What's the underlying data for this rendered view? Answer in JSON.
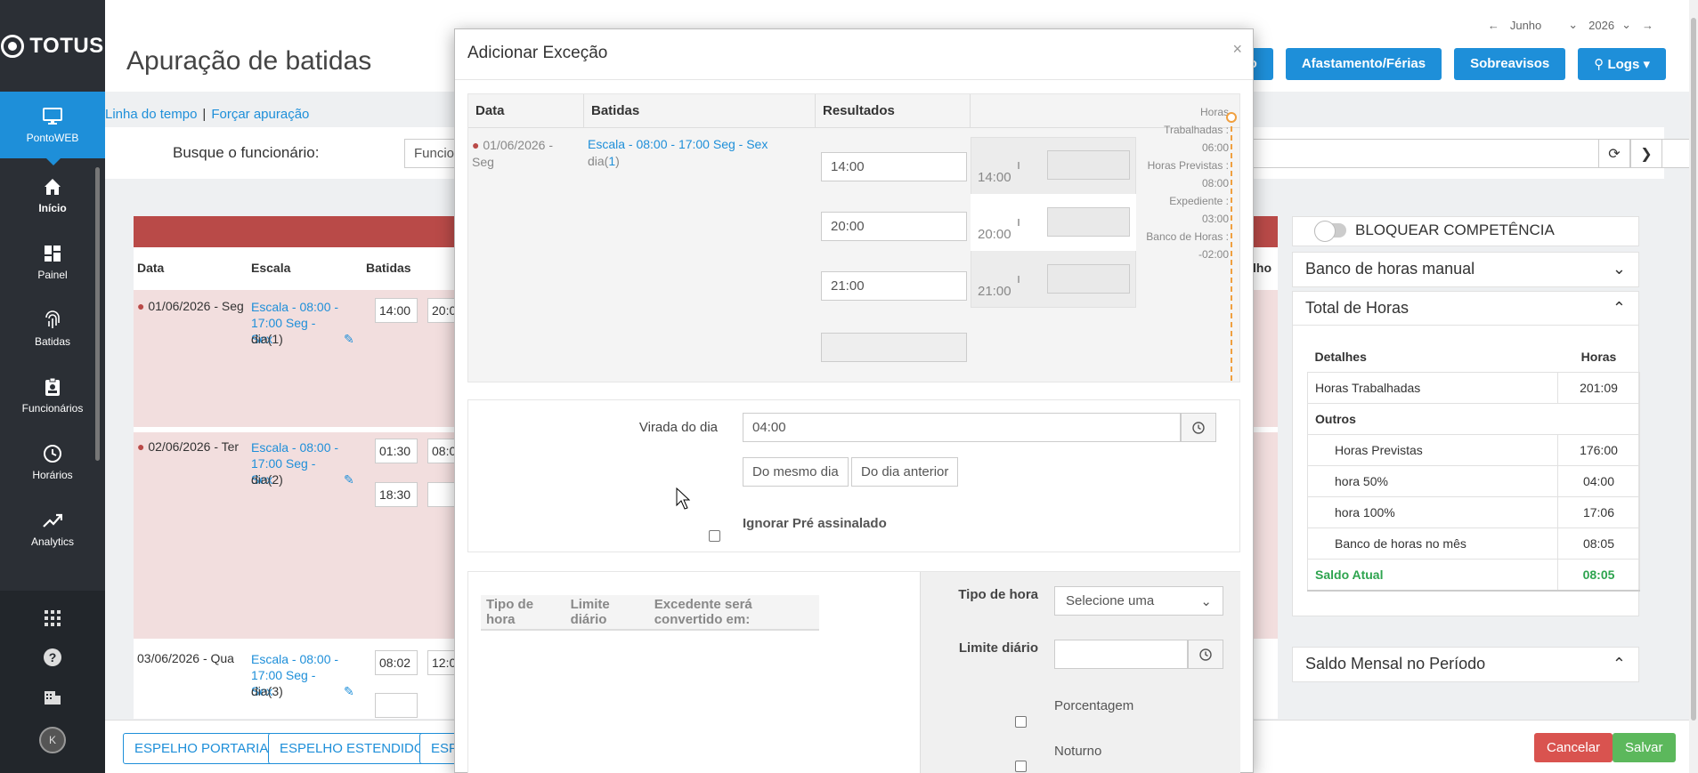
{
  "app": {
    "logo": "TOTUS",
    "page_title": "Apuração de batidas"
  },
  "sidebar": {
    "items": [
      {
        "label": "PontoWEB",
        "icon": "monitor-icon"
      },
      {
        "label": "Início",
        "icon": "home-icon"
      },
      {
        "label": "Painel",
        "icon": "dashboard-icon"
      },
      {
        "label": "Batidas",
        "icon": "fingerprint-icon"
      },
      {
        "label": "Funcionários",
        "icon": "badge-icon"
      },
      {
        "label": "Horários",
        "icon": "clock-icon"
      },
      {
        "label": "Analytics",
        "icon": "trending-icon"
      }
    ],
    "avatar_initial": "K"
  },
  "header": {
    "month": "Junho",
    "year": "2026",
    "buttons": {
      "partial": "ário",
      "afastamento": "Afastamento/Férias",
      "sobreavisos": "Sobreavisos",
      "logs": "Logs"
    }
  },
  "links": {
    "timeline": "Linha do tempo",
    "sep": "|",
    "force": "Forçar apuração"
  },
  "search": {
    "label": "Busque o funcionário:",
    "placeholder": "Funcio"
  },
  "table": {
    "headers": {
      "data": "Data",
      "escala": "Escala",
      "batidas": "Batidas",
      "partial": "lho"
    },
    "rows": [
      {
        "date": "01/06/2026 - Seg",
        "escala": "Escala - 08:00 - 17:00 Seg - Sex",
        "dia": "dia(1)",
        "batidas": [
          "14:00",
          "20:0"
        ]
      },
      {
        "date": "02/06/2026 - Ter",
        "escala": "Escala - 08:00 - 17:00 Seg - Sex",
        "dia": "dia(2)",
        "batidas": [
          "01:30",
          "08:0",
          "18:30",
          ""
        ]
      },
      {
        "date": "03/06/2026 - Qua",
        "escala": "Escala - 08:00 - 17:00 Seg - Sex",
        "dia": "dia(3)",
        "batidas": [
          "08:02",
          "12:0",
          ""
        ]
      }
    ]
  },
  "right_panels": {
    "bloquear": "BLOQUEAR COMPETÊNCIA",
    "banco_manual": "Banco de horas manual",
    "total_horas": "Total de Horas",
    "total_table": {
      "headers": [
        "Detalhes",
        "Horas"
      ],
      "rows": [
        {
          "label": "Horas Trabalhadas",
          "value": "201:09"
        },
        {
          "label": "Outros",
          "value": ""
        },
        {
          "label": "Horas Previstas",
          "value": "176:00"
        },
        {
          "label": "hora 50%",
          "value": "04:00"
        },
        {
          "label": "hora 100%",
          "value": "17:06"
        },
        {
          "label": "Banco de horas no mês",
          "value": "08:05"
        }
      ],
      "saldo_label": "Saldo Atual",
      "saldo_value": "08:05"
    },
    "saldo_mensal": "Saldo Mensal no Período"
  },
  "bottom": {
    "espelho_portaria": "ESPELHO PORTARIA",
    "espelho_estendido": "ESPELHO ESTENDIDO",
    "partial": "ESP",
    "cancelar": "Cancelar",
    "salvar": "Salvar"
  },
  "modal": {
    "title": "Adicionar Exceção",
    "close": "×",
    "headers": {
      "data": "Data",
      "batidas": "Batidas",
      "resultados": "Resultados"
    },
    "row": {
      "date": "01/06/2026 -",
      "weekday": "Seg",
      "escala": "Escala - 08:00 - 17:00 Seg - Sex",
      "dia_prefix": "dia(",
      "dia_num": "1",
      "dia_suffix": ")",
      "inputs": [
        "14:00",
        "20:00",
        "21:00",
        ""
      ],
      "results": [
        "14:00",
        "20:00",
        "21:00"
      ]
    },
    "summary": [
      "Horas",
      "Trabalhadas :",
      "06:00",
      "Horas Previstas :",
      "08:00",
      "Expediente :",
      "03:00",
      "Banco de Horas :",
      "-02:00"
    ],
    "virada_label": "Virada do dia",
    "virada_value": "04:00",
    "mesmo_dia": "Do mesmo dia",
    "dia_anterior": "Do dia anterior",
    "ignorar": "Ignorar Pré assinalado",
    "tipo_table_headers": [
      "Tipo de hora",
      "Limite diário",
      "Excedente será convertido em:"
    ],
    "tipo_hora_label": "Tipo de hora",
    "tipo_hora_value": "Selecione uma",
    "limite_label": "Limite diário",
    "porcentagem": "Porcentagem",
    "noturno": "Noturno"
  }
}
